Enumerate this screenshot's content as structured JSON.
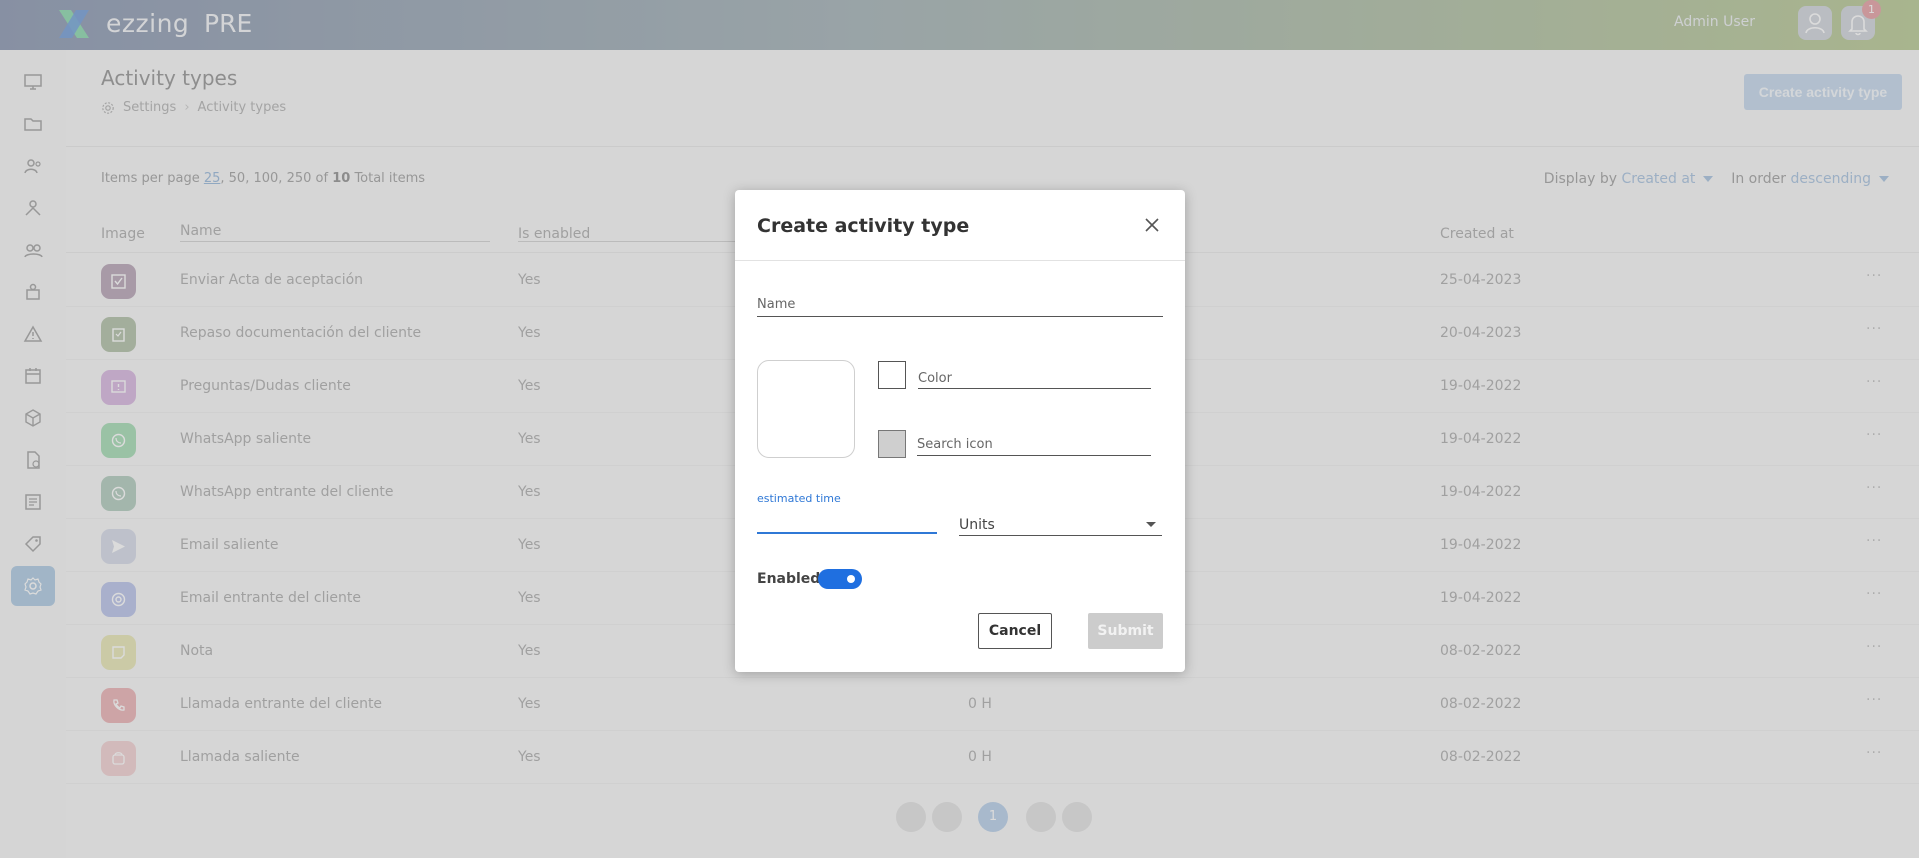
{
  "app": {
    "logo_text": "ezzing",
    "environment": "PRE",
    "user_name": "Admin User",
    "notification_count": "1"
  },
  "sidebar": {
    "items": [
      {
        "icon": "dashboard-icon"
      },
      {
        "icon": "folder-icon"
      },
      {
        "icon": "users-icon"
      },
      {
        "icon": "team-icon"
      },
      {
        "icon": "contacts-icon"
      },
      {
        "icon": "organization-icon"
      },
      {
        "icon": "warning-icon"
      },
      {
        "icon": "calendar-icon"
      },
      {
        "icon": "box-icon"
      },
      {
        "icon": "document-icon"
      },
      {
        "icon": "inbox-icon"
      },
      {
        "icon": "tag-icon"
      },
      {
        "icon": "settings-icon",
        "active": true
      }
    ]
  },
  "page": {
    "title": "Activity types",
    "breadcrumb": [
      "Settings",
      "Activity types"
    ],
    "create_button": "Create activity type"
  },
  "pagination": {
    "label": "Items per page",
    "options": [
      "25",
      "50",
      "100",
      "250"
    ],
    "selected": "25",
    "of": "of",
    "total": "10",
    "total_label": "Total items",
    "current_page": "1"
  },
  "sort": {
    "display_by_label": "Display by",
    "display_by_value": "Created at",
    "order_label": "In order",
    "order_value": "descending"
  },
  "table": {
    "headers": {
      "image": "Image",
      "name": "Name",
      "is_enabled": "Is enabled",
      "created_at": "Created at"
    },
    "rows": [
      {
        "name": "Enviar Acta de aceptación",
        "enabled": "Yes",
        "estimated": "",
        "created_at": "25-04-2023",
        "color": "#a78fa6",
        "icon": "checkbox-icon"
      },
      {
        "name": "Repaso documentación del cliente",
        "enabled": "Yes",
        "estimated": "",
        "created_at": "20-04-2023",
        "color": "#9fb193",
        "icon": "clipboard-icon"
      },
      {
        "name": "Preguntas/Dudas cliente",
        "enabled": "Yes",
        "estimated": "",
        "created_at": "19-04-2022",
        "color": "#cfa6d9",
        "icon": "question-icon"
      },
      {
        "name": "WhatsApp saliente",
        "enabled": "Yes",
        "estimated": "",
        "created_at": "19-04-2022",
        "color": "#8fd4a3",
        "icon": "whatsapp-icon"
      },
      {
        "name": "WhatsApp entrante del cliente",
        "enabled": "Yes",
        "estimated": "",
        "created_at": "19-04-2022",
        "color": "#9fc0ae",
        "icon": "whatsapp-icon"
      },
      {
        "name": "Email saliente",
        "enabled": "Yes",
        "estimated": "",
        "created_at": "19-04-2022",
        "color": "#cdd3e4",
        "icon": "send-icon"
      },
      {
        "name": "Email entrante del cliente",
        "enabled": "Yes",
        "estimated": "",
        "created_at": "19-04-2022",
        "color": "#a9b6e6",
        "icon": "at-icon"
      },
      {
        "name": "Nota",
        "enabled": "Yes",
        "estimated": "",
        "created_at": "08-02-2022",
        "color": "#e3e2a4",
        "icon": "note-icon"
      },
      {
        "name": "Llamada entrante del cliente",
        "enabled": "Yes",
        "estimated": "0 H",
        "created_at": "08-02-2022",
        "color": "#e7a0a4",
        "icon": "phone-icon"
      },
      {
        "name": "Llamada saliente",
        "enabled": "Yes",
        "estimated": "0 H",
        "created_at": "08-02-2022",
        "color": "#efc7c9",
        "icon": "phone-out-icon"
      }
    ]
  },
  "modal": {
    "title": "Create activity type",
    "name_label": "Name",
    "color_label": "Color",
    "search_icon_label": "Search icon",
    "estimated_time_label": "estimated time",
    "units_label": "Units",
    "enabled_label": "Enabled:",
    "enabled_value": true,
    "cancel_label": "Cancel",
    "submit_label": "Submit"
  }
}
